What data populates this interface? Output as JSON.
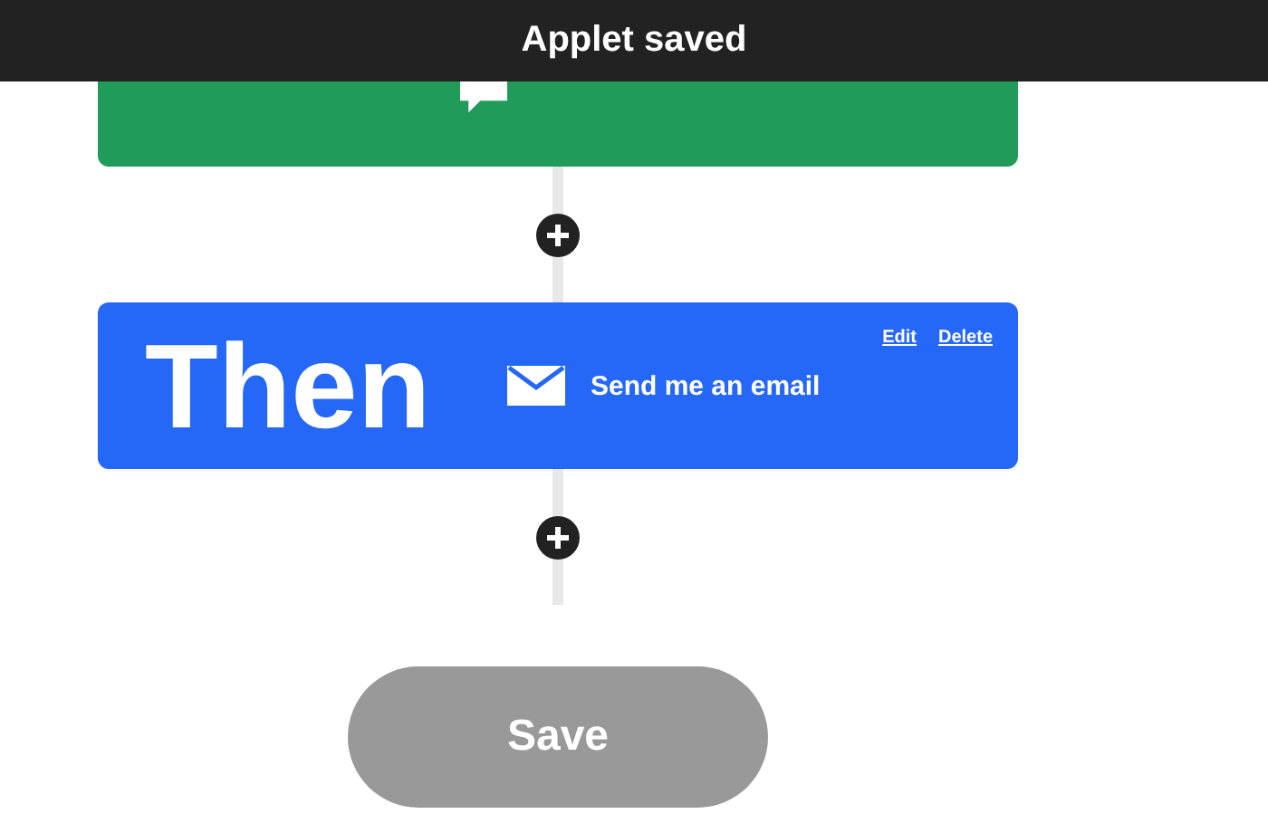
{
  "toast": {
    "message": "Applet saved"
  },
  "steps": [
    {
      "kind": "trigger",
      "color": "#209b5a"
    },
    {
      "kind": "action",
      "heading": "Then",
      "action": "Send me an email",
      "color": "#2567f6",
      "links": [
        "Edit",
        "Delete"
      ]
    }
  ],
  "save_button": {
    "label": "Save",
    "disabled": true
  }
}
